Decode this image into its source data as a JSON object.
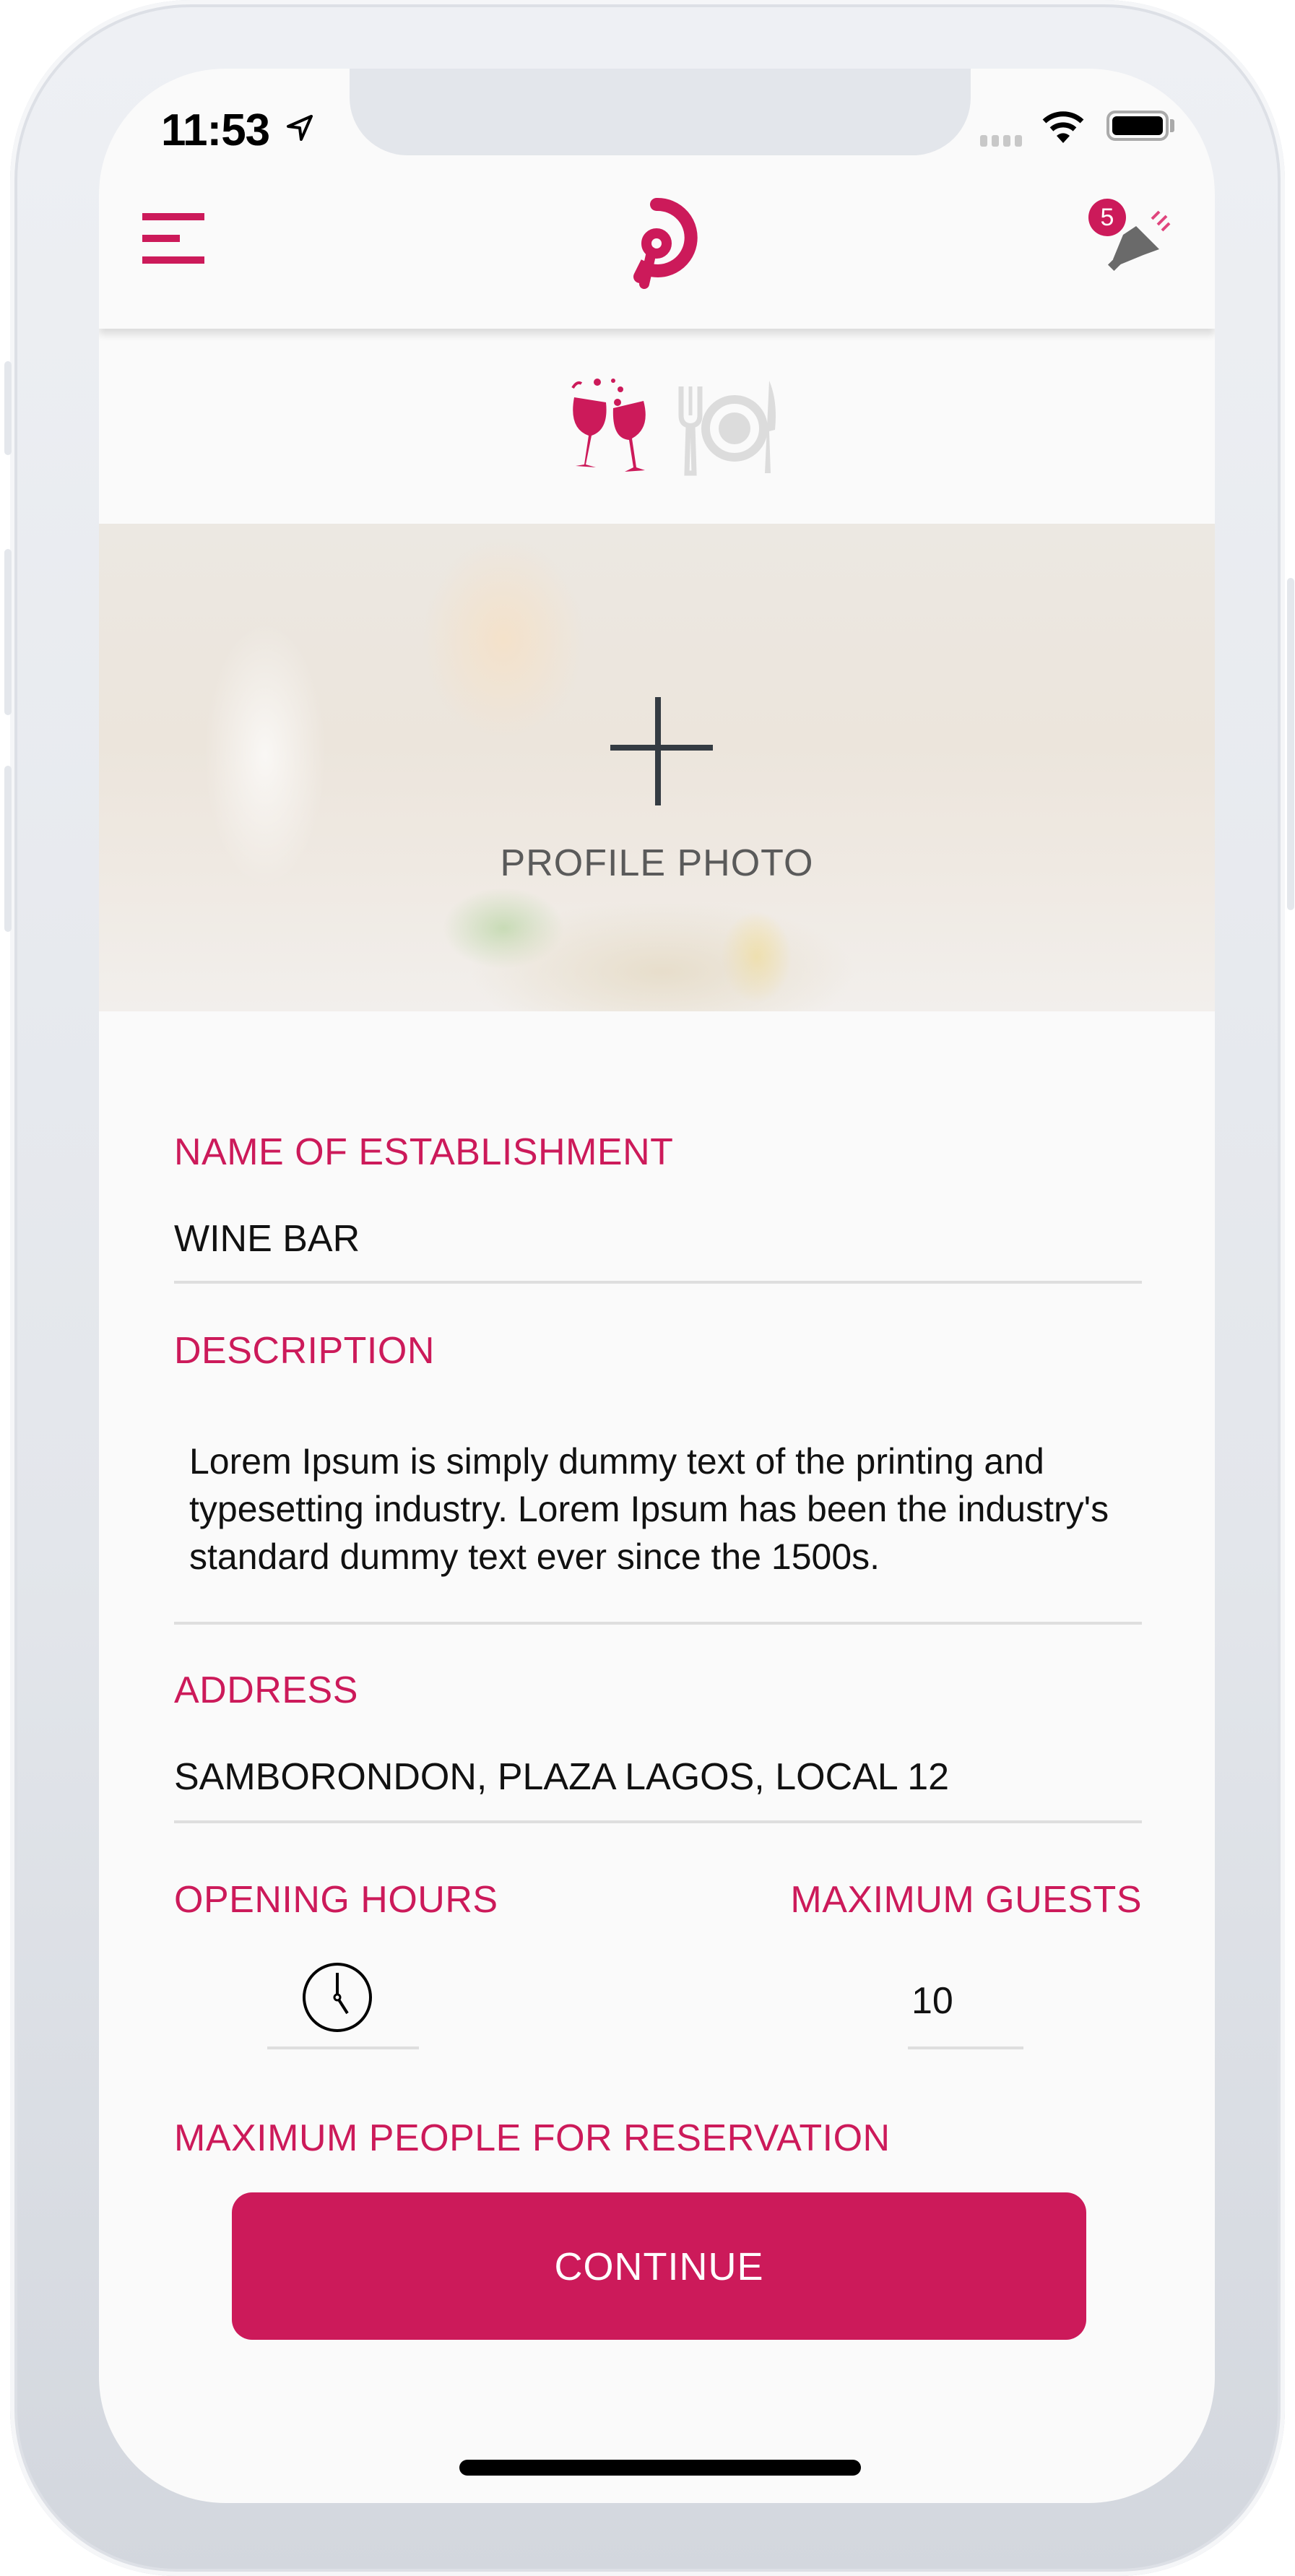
{
  "status_bar": {
    "time": "11:53",
    "location_icon": "location-arrow-icon",
    "signal_icon": "cellular-signal-icon",
    "wifi_icon": "wifi-icon",
    "battery_icon": "battery-icon"
  },
  "navbar": {
    "menu_icon": "hamburger-menu-icon",
    "logo_icon": "app-logo-icon",
    "notifications_icon": "megaphone-icon",
    "notification_count": "5"
  },
  "category_tabs": [
    {
      "name": "bar",
      "icon": "wine-glasses-icon",
      "active": true
    },
    {
      "name": "restaurant",
      "icon": "plate-fork-knife-icon",
      "active": false
    }
  ],
  "profile_photo": {
    "add_icon": "plus-icon",
    "label": "PROFILE PHOTO"
  },
  "form": {
    "name": {
      "label": "NAME OF ESTABLISHMENT",
      "value": "WINE BAR"
    },
    "description": {
      "label": "DESCRIPTION",
      "value": "Lorem Ipsum is simply dummy text of the printing and typesetting industry. Lorem Ipsum has been the industry's standard dummy text ever since the 1500s."
    },
    "address": {
      "label": "ADDRESS",
      "value": "SAMBORONDON, PLAZA LAGOS, LOCAL 12"
    },
    "opening_hours": {
      "label": "OPENING HOURS",
      "icon": "clock-icon"
    },
    "maximum_guests": {
      "label": "MAXIMUM GUESTS",
      "value": "10"
    },
    "max_people_reservation": {
      "label": "MAXIMUM PEOPLE FOR RESERVATION"
    }
  },
  "actions": {
    "continue_label": "CONTINUE"
  },
  "colors": {
    "accent": "#cc1a5a",
    "inactive_icon": "#dcdcdc",
    "text": "#111111",
    "divider": "#dedede"
  }
}
